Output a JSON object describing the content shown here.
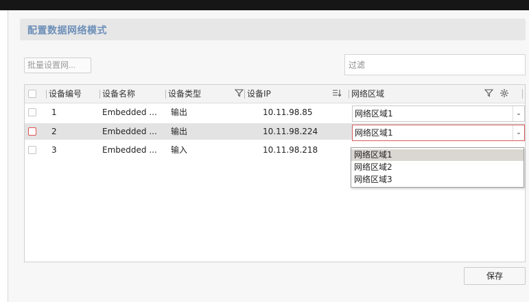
{
  "page": {
    "title": "配置数据网络模式"
  },
  "toolbar": {
    "batch_label": "批量设置网...",
    "filter_placeholder": "过滤",
    "filter_value": ""
  },
  "table": {
    "headers": {
      "device_no": "设备编号",
      "device_name": "设备名称",
      "device_type": "设备类型",
      "device_ip": "设备IP",
      "network_zone": "网络区域"
    },
    "rows": [
      {
        "no": "1",
        "name": "Embedded ...",
        "type": "输出",
        "ip": "10.11.98.85",
        "zone": "网络区域1",
        "selected": false
      },
      {
        "no": "2",
        "name": "Embedded ...",
        "type": "输出",
        "ip": "10.11.98.224",
        "zone": "网络区域1",
        "selected": true
      },
      {
        "no": "3",
        "name": "Embedded ...",
        "type": "输入",
        "ip": "10.11.98.218",
        "zone": "",
        "selected": false
      }
    ]
  },
  "dropdown": {
    "options": [
      "网络区域1",
      "网络区域2",
      "网络区域3"
    ],
    "highlighted": "网络区域1"
  },
  "footer": {
    "save_label": "保存"
  },
  "icons": {
    "filter": "filter-icon",
    "sort": "sort-icon",
    "settings": "gear-icon",
    "chevron": "chevron-down-icon"
  },
  "colors": {
    "title_text": "#6d8fb8",
    "active_border": "#d65a5a",
    "selected_row": "#e3e3e3",
    "top_bar": "#161616"
  }
}
